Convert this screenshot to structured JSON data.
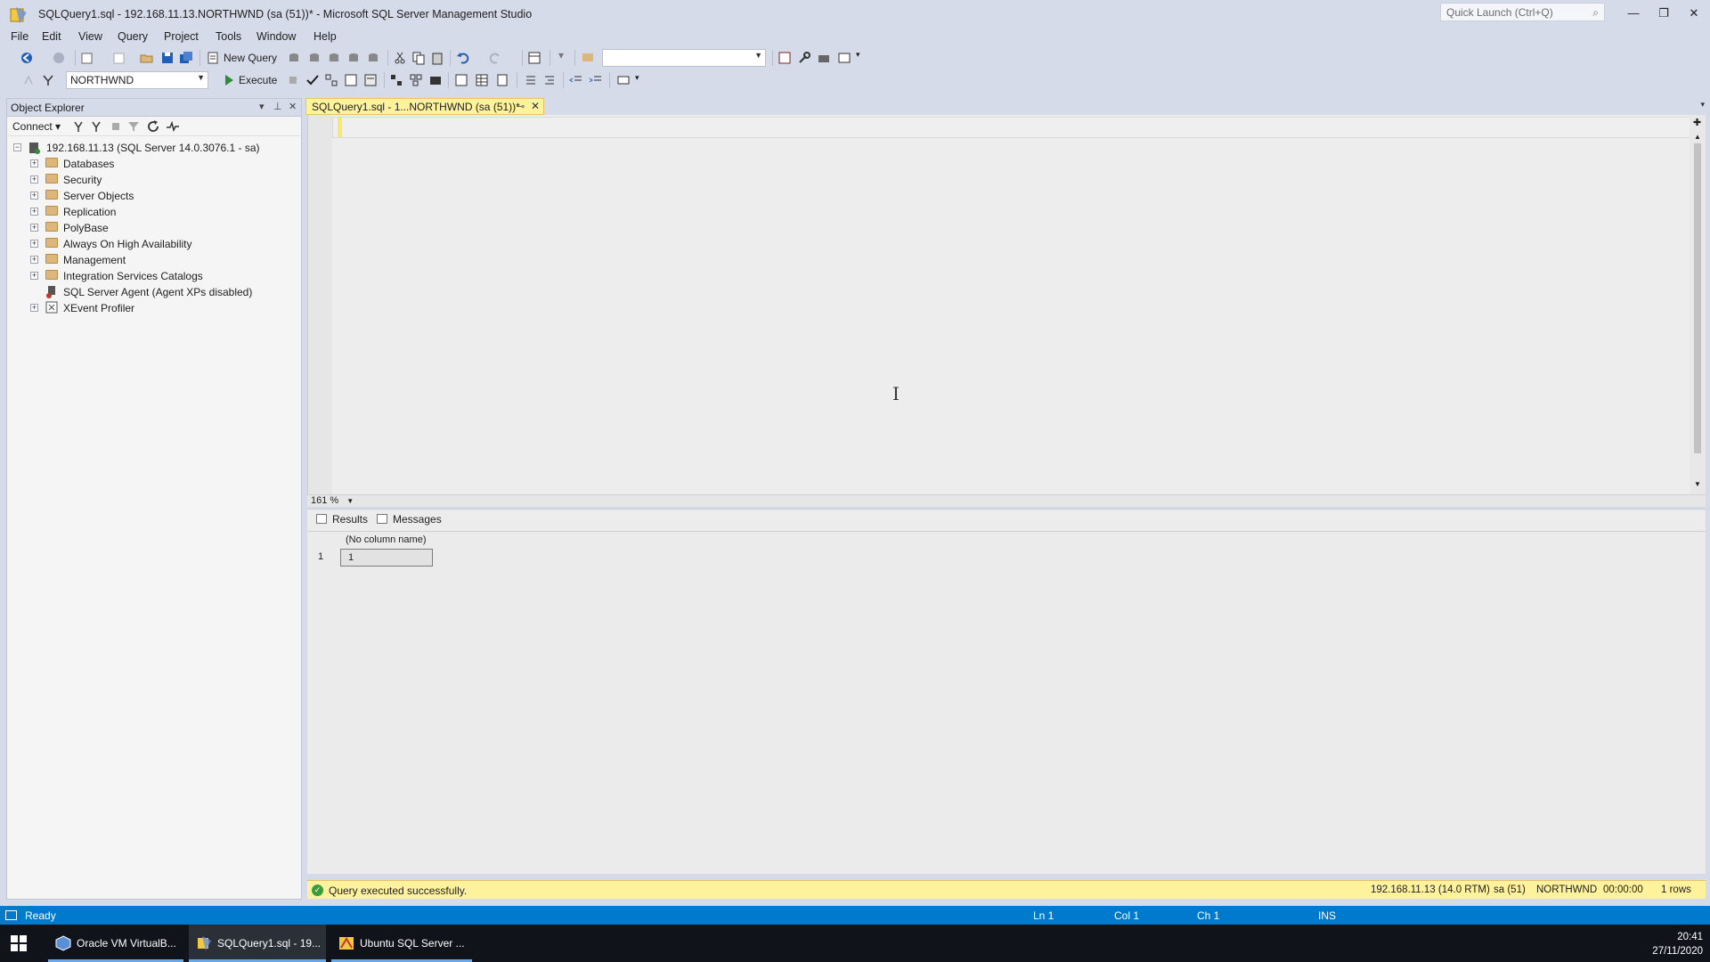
{
  "window": {
    "title": "SQLQuery1.sql - 192.168.11.13.NORTHWND (sa (51))* - Microsoft SQL Server Management Studio",
    "quick_launch_placeholder": "Quick Launch (Ctrl+Q)"
  },
  "menu": [
    "File",
    "Edit",
    "View",
    "Query",
    "Project",
    "Tools",
    "Window",
    "Help"
  ],
  "toolbar": {
    "new_query_label": "New Query",
    "database_combo": "NORTHWND",
    "execute_label": "Execute"
  },
  "object_explorer": {
    "title": "Object Explorer",
    "connect_label": "Connect",
    "server_node": "192.168.11.13 (SQL Server 14.0.3076.1 - sa)",
    "nodes": [
      "Databases",
      "Security",
      "Server Objects",
      "Replication",
      "PolyBase",
      "Always On High Availability",
      "Management",
      "Integration Services Catalogs",
      "SQL Server Agent (Agent XPs disabled)",
      "XEvent Profiler"
    ]
  },
  "editor": {
    "tab_label": "SQLQuery1.sql - 1...NORTHWND (sa (51))*",
    "zoom": "161 %"
  },
  "results": {
    "tabs": [
      "Results",
      "Messages"
    ],
    "column_header": "(No column name)",
    "row_number": "1",
    "cell_value": "1"
  },
  "query_status": {
    "message": "Query executed successfully.",
    "server": "192.168.11.13 (14.0 RTM)",
    "user": "sa (51)",
    "database": "NORTHWND",
    "elapsed": "00:00:00",
    "rows": "1 rows"
  },
  "app_status": {
    "ready": "Ready",
    "ln": "Ln 1",
    "col": "Col 1",
    "ch": "Ch 1",
    "mode": "INS"
  },
  "taskbar": {
    "items": [
      "Oracle VM VirtualB...",
      "SQLQuery1.sql - 19...",
      "Ubuntu SQL Server ..."
    ],
    "time": "20:41",
    "date": "27/11/2020"
  },
  "colors": {
    "accent_blue": "#007acc",
    "tab_yellow": "#fff29d",
    "chrome": "#d6dbe9"
  }
}
